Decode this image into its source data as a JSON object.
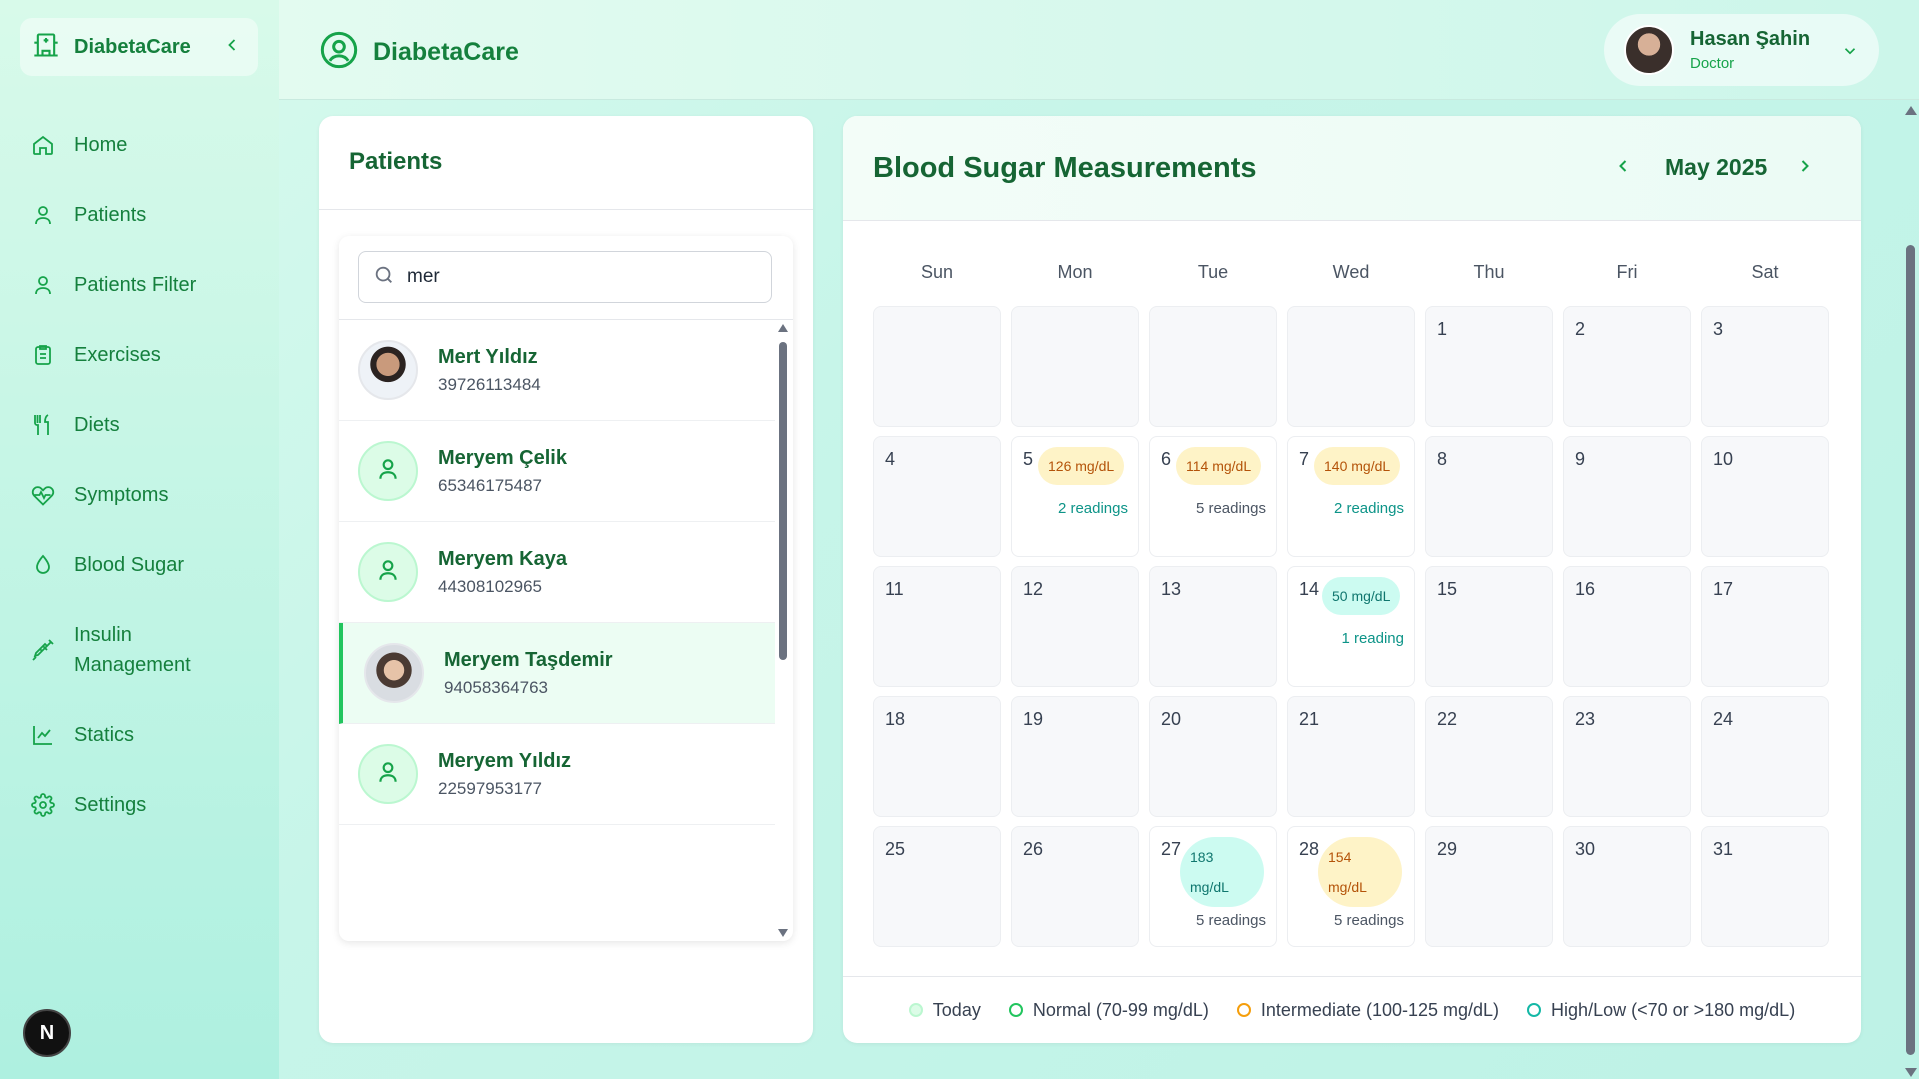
{
  "app": {
    "name": "DiabetaCare"
  },
  "sidebar": {
    "items": [
      {
        "label": "Home",
        "icon": "home-icon"
      },
      {
        "label": "Patients",
        "icon": "user-icon"
      },
      {
        "label": "Patients Filter",
        "icon": "user-icon"
      },
      {
        "label": "Exercises",
        "icon": "clipboard-icon"
      },
      {
        "label": "Diets",
        "icon": "utensils-icon"
      },
      {
        "label": "Symptoms",
        "icon": "heart-pulse-icon"
      },
      {
        "label": "Blood Sugar",
        "icon": "droplet-icon"
      },
      {
        "label": "Insulin Management",
        "icon": "syringe-icon"
      },
      {
        "label": "Statics",
        "icon": "line-chart-icon"
      },
      {
        "label": "Settings",
        "icon": "gear-icon"
      }
    ],
    "badge": "N"
  },
  "user": {
    "name": "Hasan Şahin",
    "role": "Doctor"
  },
  "patients_panel": {
    "title": "Patients",
    "search_value": "mer",
    "rows": [
      {
        "name": "Mert Yıldız",
        "id": "39726113484"
      },
      {
        "name": "Meryem Çelik",
        "id": "65346175487"
      },
      {
        "name": "Meryem Kaya",
        "id": "44308102965"
      },
      {
        "name": "Meryem Taşdemir",
        "id": "94058364763"
      },
      {
        "name": "Meryem Yıldız",
        "id": "22597953177"
      }
    ]
  },
  "calendar": {
    "title": "Blood Sugar Measurements",
    "month": "May 2025",
    "weekdays": [
      "Sun",
      "Mon",
      "Tue",
      "Wed",
      "Thu",
      "Fri",
      "Sat"
    ],
    "days": [
      "1",
      "2",
      "3",
      "4",
      "5",
      "6",
      "7",
      "8",
      "9",
      "10",
      "11",
      "12",
      "13",
      "14",
      "15",
      "16",
      "17",
      "18",
      "19",
      "20",
      "21",
      "22",
      "23",
      "24",
      "25",
      "26",
      "27",
      "28",
      "29",
      "30",
      "31"
    ],
    "entries": {
      "d5": {
        "value": "126 mg/dL",
        "readings": "2 readings"
      },
      "d6": {
        "value": "114 mg/dL",
        "readings": "5 readings"
      },
      "d7": {
        "value": "140 mg/dL",
        "readings": "2 readings"
      },
      "d14": {
        "value": "50 mg/dL",
        "readings": "1 reading"
      },
      "d27": {
        "value": "183 mg/dL",
        "readings": "5 readings"
      },
      "d28": {
        "value": "154 mg/dL",
        "readings": "5 readings"
      }
    },
    "legend": [
      "Today",
      "Normal (70-99 mg/dL)",
      "Intermediate (100-125 mg/dL)",
      "High/Low (<70 or >180 mg/dL)"
    ]
  },
  "colors": {
    "brand": "#15803d",
    "accent": "#22c55e",
    "intermediate": "#f59e0b",
    "highlow": "#14b8a6"
  }
}
